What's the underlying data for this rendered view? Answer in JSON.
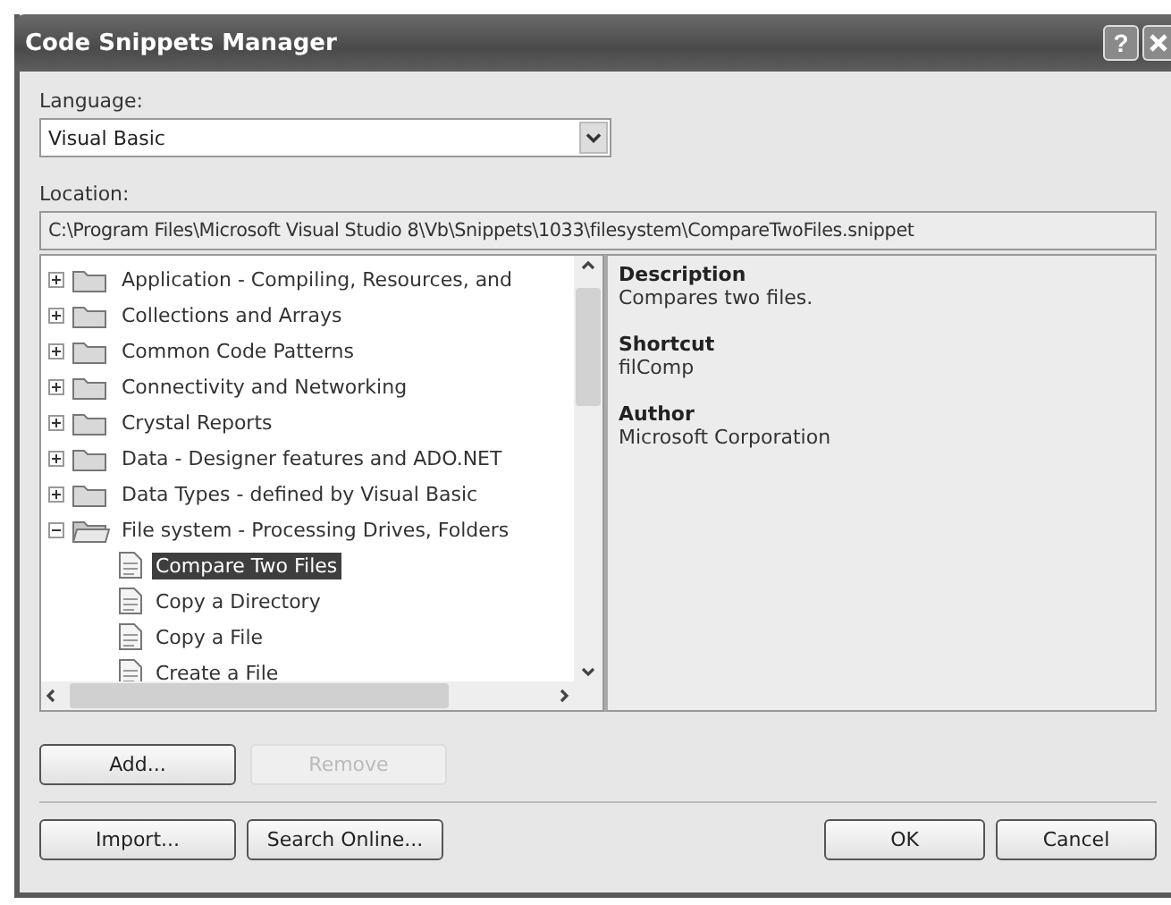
{
  "window": {
    "title": "Code Snippets Manager",
    "help": "?"
  },
  "language": {
    "label": "Language:",
    "value": "Visual Basic"
  },
  "location": {
    "label": "Location:",
    "value": "C:\\Program Files\\Microsoft Visual Studio 8\\Vb\\Snippets\\1033\\filesystem\\CompareTwoFiles.snippet"
  },
  "tree": [
    {
      "label": "Application - Compiling, Resources, and",
      "expanded": false,
      "selected": false
    },
    {
      "label": "Collections and Arrays",
      "expanded": false,
      "selected": false
    },
    {
      "label": "Common Code Patterns",
      "expanded": false,
      "selected": false
    },
    {
      "label": "Connectivity and Networking",
      "expanded": false,
      "selected": false
    },
    {
      "label": "Crystal Reports",
      "expanded": false,
      "selected": false
    },
    {
      "label": "Data - Designer features and ADO.NET",
      "expanded": false,
      "selected": false
    },
    {
      "label": "Data Types - defined by Visual Basic",
      "expanded": false,
      "selected": false
    },
    {
      "label": "File system - Processing Drives, Folders",
      "expanded": true,
      "selected": false,
      "children": [
        {
          "label": "Compare Two Files",
          "selected": true
        },
        {
          "label": "Copy a Directory",
          "selected": false
        },
        {
          "label": "Copy a File",
          "selected": false
        },
        {
          "label": "Create a File",
          "selected": false
        }
      ]
    }
  ],
  "details": [
    {
      "heading": "Description",
      "value": "Compares two files."
    },
    {
      "heading": "Shortcut",
      "value": "filComp"
    },
    {
      "heading": "Author",
      "value": "Microsoft Corporation"
    }
  ],
  "snippet_buttons": [
    {
      "label": "Add...",
      "disabled": false
    },
    {
      "label": "Remove",
      "disabled": true
    }
  ],
  "footer_left": [
    {
      "label": "Import...",
      "disabled": false
    },
    {
      "label": "Search Online...",
      "disabled": false
    }
  ],
  "footer_right": [
    {
      "label": "OK",
      "disabled": false
    },
    {
      "label": "Cancel",
      "disabled": false
    }
  ]
}
